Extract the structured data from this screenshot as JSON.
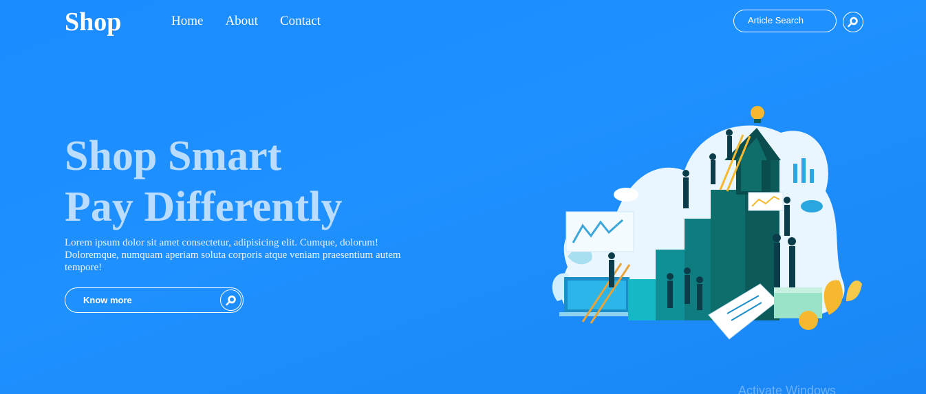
{
  "nav": {
    "logo": "Shop",
    "links": [
      "Home",
      "About",
      "Contact"
    ],
    "search_label": "Article Search"
  },
  "hero": {
    "title_line1": "Shop Smart",
    "title_line2": "Pay Differently",
    "description": "Lorem ipsum dolor sit amet consectetur, adipisicing elit. Cumque, dolorum! Doloremque, numquam aperiam soluta corporis atque veniam praesentium autem tempore!",
    "button_label": "Know more"
  },
  "icons": {
    "search": "search-icon",
    "illustration": "growth-illustration"
  },
  "colors": {
    "background": "#1f90ff",
    "title": "#b9dcff",
    "teal": "#0f6e6a",
    "accent": "#f5b82e"
  },
  "os_overlay": "Activate Windows"
}
